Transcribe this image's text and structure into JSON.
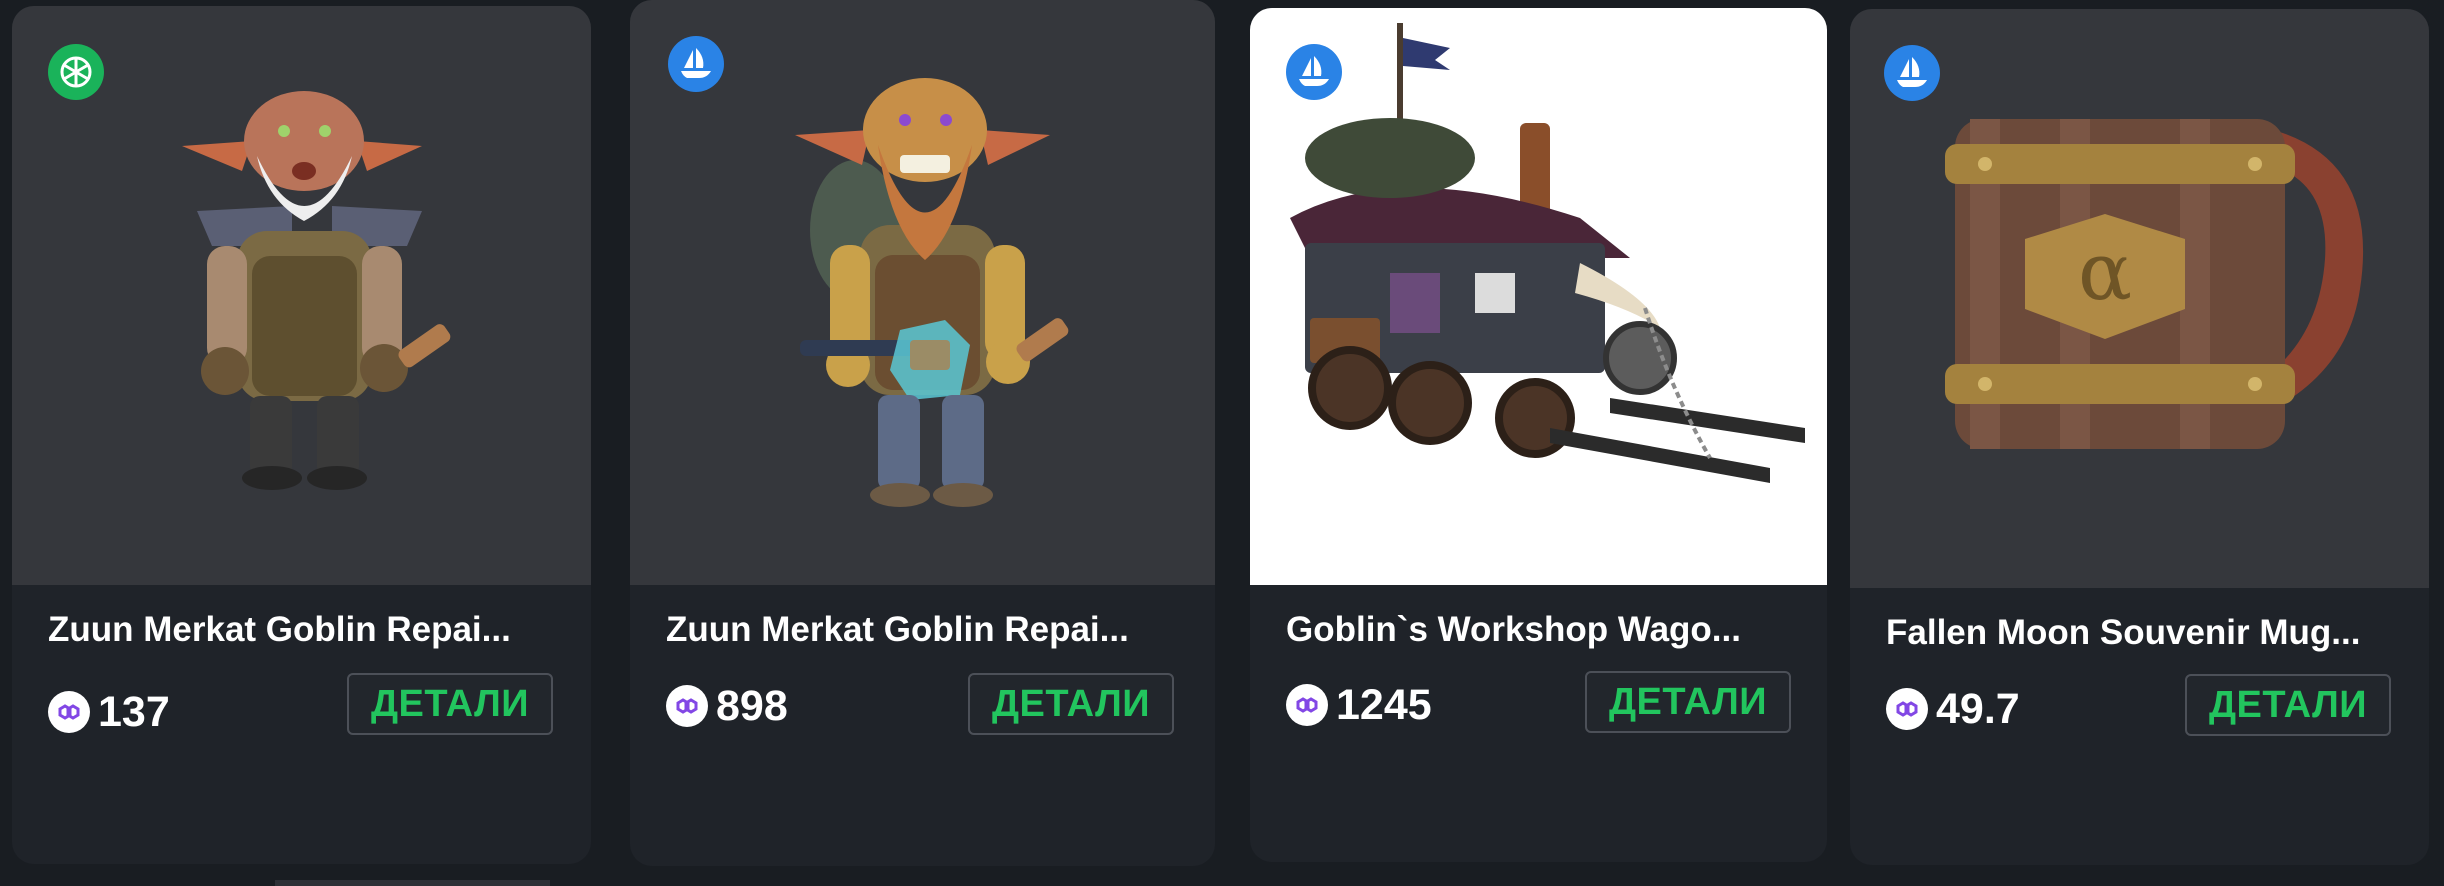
{
  "cards": [
    {
      "title": "Zuun Merkat Goblin Repai...",
      "price": "137",
      "button_label": "ДЕТАЛИ",
      "marketplace_icon": "green-marketplace-icon",
      "image_icon": "goblin-repairman-white-beard-icon"
    },
    {
      "title": "Zuun Merkat Goblin Repai...",
      "price": "898",
      "button_label": "ДЕТАЛИ",
      "marketplace_icon": "opensea-boat-icon",
      "image_icon": "goblin-repairman-braided-beard-icon"
    },
    {
      "title": "Goblin`s Workshop Wago...",
      "price": "1245",
      "button_label": "ДЕТАЛИ",
      "marketplace_icon": "opensea-boat-icon",
      "image_icon": "workshop-wagon-icon"
    },
    {
      "title": "Fallen Moon Souvenir Mug...",
      "price": "49.7",
      "button_label": "ДЕТАЛИ",
      "marketplace_icon": "opensea-boat-icon",
      "image_icon": "wooden-mug-icon"
    }
  ],
  "colors": {
    "background": "#191d22",
    "card": "#1f2329",
    "image_area": "#35373c",
    "accent_green": "#22c55e",
    "opensea_blue": "#2a83e6",
    "green_badge": "#1ab35a",
    "polygon_purple": "#8247e5"
  }
}
